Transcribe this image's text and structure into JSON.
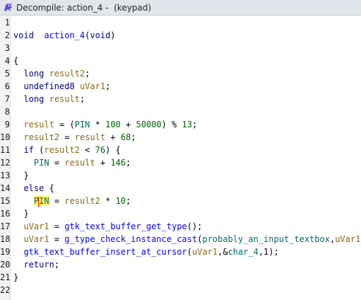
{
  "window": {
    "title": "Decompile: action_4 -  (keypad)",
    "icon": "ghidra-dragon-icon",
    "accent_color": "#6a4cd6"
  },
  "lines": [
    {
      "num": "1",
      "tokens": []
    },
    {
      "num": "2",
      "tokens": [
        [
          "kw",
          "void"
        ],
        [
          "",
          "  "
        ],
        [
          "fn",
          "action_4"
        ],
        [
          "",
          "("
        ],
        [
          "kw",
          "void"
        ],
        [
          "",
          ")"
        ]
      ]
    },
    {
      "num": "3",
      "tokens": []
    },
    {
      "num": "4",
      "tokens": [
        [
          "",
          "{"
        ]
      ]
    },
    {
      "num": "5",
      "tokens": [
        [
          "",
          "  "
        ],
        [
          "kw",
          "long"
        ],
        [
          "",
          " "
        ],
        [
          "var",
          "result2"
        ],
        [
          "",
          ";"
        ]
      ]
    },
    {
      "num": "6",
      "tokens": [
        [
          "",
          "  "
        ],
        [
          "kw",
          "undefined8"
        ],
        [
          "",
          " "
        ],
        [
          "var",
          "uVar1"
        ],
        [
          "",
          ";"
        ]
      ]
    },
    {
      "num": "7",
      "tokens": [
        [
          "",
          "  "
        ],
        [
          "kw",
          "long"
        ],
        [
          "",
          " "
        ],
        [
          "var",
          "result"
        ],
        [
          "",
          ";"
        ]
      ]
    },
    {
      "num": "8",
      "tokens": []
    },
    {
      "num": "9",
      "tokens": [
        [
          "",
          "  "
        ],
        [
          "var",
          "result"
        ],
        [
          "",
          " = ("
        ],
        [
          "gl",
          "PIN"
        ],
        [
          "",
          " * "
        ],
        [
          "num",
          "100"
        ],
        [
          "",
          " + "
        ],
        [
          "num",
          "50000"
        ],
        [
          "",
          ") % "
        ],
        [
          "num",
          "13"
        ],
        [
          "",
          ";"
        ]
      ]
    },
    {
      "num": "10",
      "tokens": [
        [
          "",
          "  "
        ],
        [
          "var",
          "result2"
        ],
        [
          "",
          " = "
        ],
        [
          "var",
          "result"
        ],
        [
          "",
          " + "
        ],
        [
          "num",
          "68"
        ],
        [
          "",
          ";"
        ]
      ]
    },
    {
      "num": "11",
      "tokens": [
        [
          "",
          "  "
        ],
        [
          "kw",
          "if"
        ],
        [
          "",
          " ("
        ],
        [
          "var",
          "result2"
        ],
        [
          "",
          " < "
        ],
        [
          "num",
          "76"
        ],
        [
          "",
          ") {"
        ]
      ]
    },
    {
      "num": "12",
      "tokens": [
        [
          "",
          "    "
        ],
        [
          "gl",
          "PIN"
        ],
        [
          "",
          " = "
        ],
        [
          "var",
          "result"
        ],
        [
          "",
          " + "
        ],
        [
          "num",
          "146"
        ],
        [
          "",
          ";"
        ]
      ]
    },
    {
      "num": "13",
      "tokens": [
        [
          "",
          "  }"
        ]
      ]
    },
    {
      "num": "14",
      "tokens": [
        [
          "",
          "  "
        ],
        [
          "kw",
          "else"
        ],
        [
          "",
          " {"
        ]
      ]
    },
    {
      "num": "15",
      "tokens": [
        [
          "",
          "    "
        ],
        [
          "glhl",
          "P"
        ],
        [
          "cursor",
          ""
        ],
        [
          "glhl",
          "IN"
        ],
        [
          "",
          " = "
        ],
        [
          "var",
          "result2"
        ],
        [
          "",
          " * "
        ],
        [
          "num",
          "10"
        ],
        [
          "",
          ";"
        ]
      ]
    },
    {
      "num": "16",
      "tokens": [
        [
          "",
          "  }"
        ]
      ]
    },
    {
      "num": "17",
      "tokens": [
        [
          "",
          "  "
        ],
        [
          "var",
          "uVar1"
        ],
        [
          "",
          " = "
        ],
        [
          "fn",
          "gtk_text_buffer_get_type"
        ],
        [
          "",
          "();"
        ]
      ]
    },
    {
      "num": "18",
      "tokens": [
        [
          "",
          "  "
        ],
        [
          "var",
          "uVar1"
        ],
        [
          "",
          " = "
        ],
        [
          "fn",
          "g_type_check_instance_cast"
        ],
        [
          "",
          "("
        ],
        [
          "gl",
          "probably_an_input_textbox"
        ],
        [
          "",
          ","
        ],
        [
          "var",
          "uVar1"
        ],
        [
          "",
          ");"
        ]
      ]
    },
    {
      "num": "19",
      "tokens": [
        [
          "",
          "  "
        ],
        [
          "fn",
          "gtk_text_buffer_insert_at_cursor"
        ],
        [
          "",
          "("
        ],
        [
          "var",
          "uVar1"
        ],
        [
          "",
          ",&"
        ],
        [
          "gl",
          "char_4"
        ],
        [
          "",
          ",1);"
        ]
      ]
    },
    {
      "num": "20",
      "tokens": [
        [
          "",
          "  "
        ],
        [
          "kw",
          "return"
        ],
        [
          "",
          ";"
        ]
      ]
    },
    {
      "num": "21",
      "tokens": [
        [
          "",
          "}"
        ]
      ]
    },
    {
      "num": "22",
      "tokens": []
    }
  ]
}
